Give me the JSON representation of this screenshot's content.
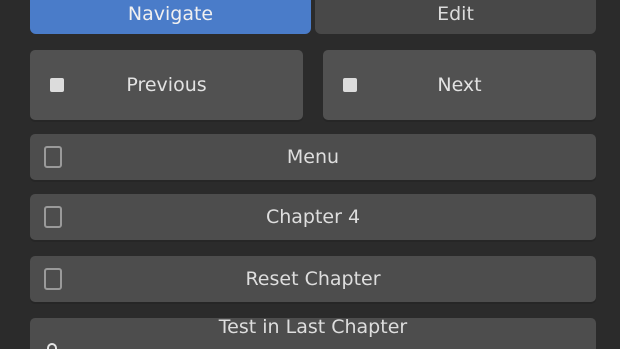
{
  "tabs": [
    {
      "label": "Navigate",
      "active": true
    },
    {
      "label": "Edit",
      "active": false
    }
  ],
  "nav": {
    "previous_label": "Previous",
    "next_label": "Next"
  },
  "rows": {
    "menu_label": "Menu",
    "chapter_label": "Chapter 4",
    "reset_label": "Reset Chapter",
    "last_chapter_label": "Test in Last Chapter"
  },
  "icons": {
    "previous": "stop-icon",
    "next": "stop-icon",
    "menu": "document-icon",
    "chapter": "document-icon",
    "reset": "document-icon",
    "last_chapter": "lock-icon"
  },
  "colors": {
    "accent": "#4a7cc9",
    "background": "#2b2b2b",
    "button": "#4d4d4d"
  }
}
